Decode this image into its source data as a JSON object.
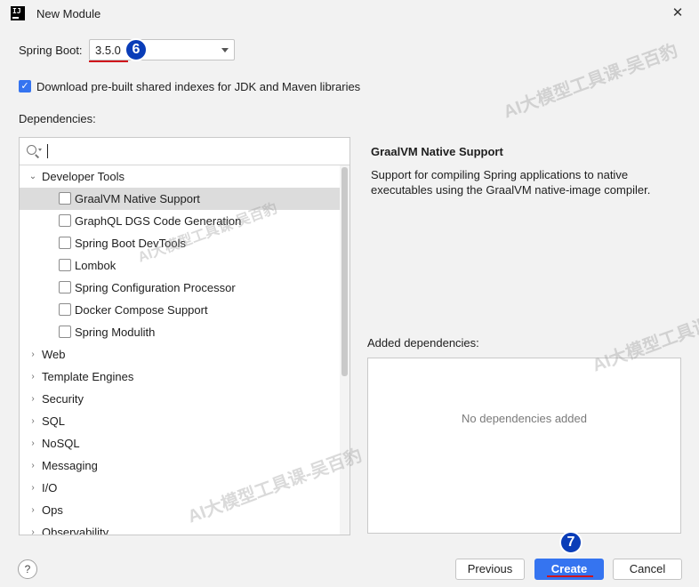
{
  "window": {
    "title": "New Module",
    "icon_text": "IJ",
    "close_glyph": "✕"
  },
  "spring_boot": {
    "label": "Spring Boot:",
    "value": "3.5.0"
  },
  "download_indexes": {
    "label": "Download pre-built shared indexes for JDK and Maven libraries",
    "checked": true
  },
  "dependencies": {
    "label": "Dependencies:",
    "search_value": "",
    "tree": {
      "expanded_category": "Developer Tools",
      "items": [
        "GraalVM Native Support",
        "GraphQL DGS Code Generation",
        "Spring Boot DevTools",
        "Lombok",
        "Spring Configuration Processor",
        "Docker Compose Support",
        "Spring Modulith"
      ],
      "selected_item": "GraalVM Native Support",
      "categories": [
        "Web",
        "Template Engines",
        "Security",
        "SQL",
        "NoSQL",
        "Messaging",
        "I/O",
        "Ops",
        "Observability"
      ]
    }
  },
  "detail": {
    "title": "GraalVM Native Support",
    "description": "Support for compiling Spring applications to native executables using the GraalVM native-image compiler."
  },
  "added": {
    "label": "Added dependencies:",
    "empty_text": "No dependencies added"
  },
  "footer": {
    "help_label": "?",
    "previous_label": "Previous",
    "create_label": "Create",
    "cancel_label": "Cancel"
  },
  "annotations": {
    "badge_6": "6",
    "badge_7": "7",
    "badge_color": "#0a3db8",
    "underline_color": "#d0151c"
  },
  "watermark": "AI大模型工具课-吴百豹",
  "colors": {
    "accent": "#3574f0",
    "selected_row": "#dcdcdc"
  }
}
